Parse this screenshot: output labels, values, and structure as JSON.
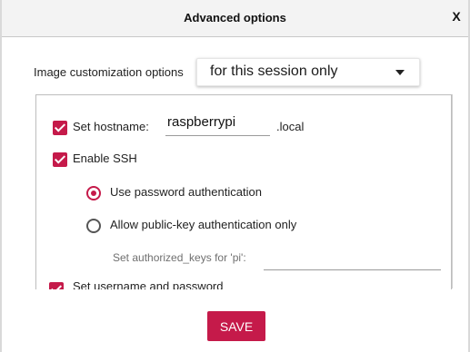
{
  "dialog": {
    "title": "Advanced options",
    "close_label": "X"
  },
  "customization": {
    "label": "Image customization options",
    "selected": "for this session only"
  },
  "options": {
    "hostname": {
      "label": "Set hostname:",
      "value": "raspberrypi",
      "suffix": ".local",
      "checked": true
    },
    "ssh": {
      "label": "Enable SSH",
      "checked": true,
      "password_auth_label": "Use password authentication",
      "pubkey_auth_label": "Allow public-key authentication only",
      "authorized_keys_label": "Set authorized_keys for 'pi':"
    },
    "username_password": {
      "label": "Set username and password",
      "checked": true
    }
  },
  "footer": {
    "save_label": "SAVE"
  },
  "colors": {
    "accent": "#c51a4a"
  }
}
